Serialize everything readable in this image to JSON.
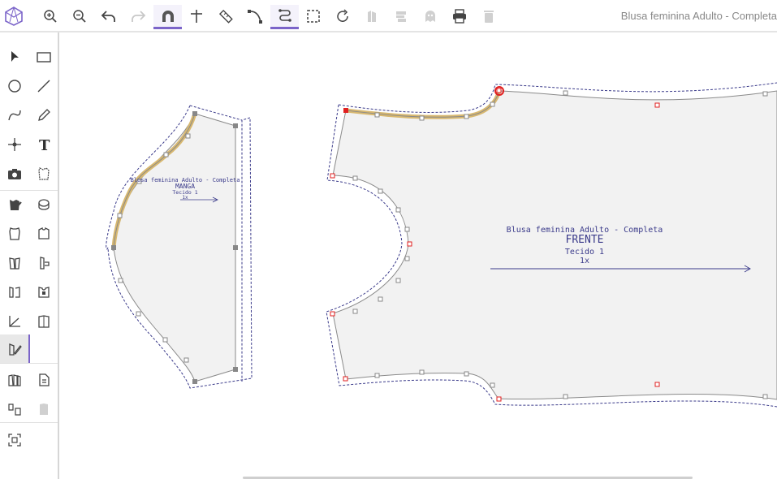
{
  "app": {
    "title": "Blusa feminina Adulto - Completa"
  },
  "toolbar": {
    "items": [
      "logo-icon",
      "zoom-in-icon",
      "zoom-out-icon",
      "undo-icon",
      "redo-icon",
      "magnet-icon",
      "cross-tool-icon",
      "ruler-icon",
      "curve-point-icon",
      "path-tool-icon",
      "selection-box-icon",
      "rotate-icon",
      "piece-copy-icon",
      "piece-layers-icon",
      "ghost-icon",
      "print-icon",
      "trash-icon"
    ],
    "active": [
      "magnet-icon",
      "path-tool-icon"
    ]
  },
  "sidebar": {
    "items": [
      "pointer-icon",
      "rectangle-icon",
      "circle-icon",
      "line-icon",
      "curve-icon",
      "pencil-icon",
      "point-icon",
      "text-icon",
      "camera-icon",
      "piece-outline-icon",
      "piece-check-icon",
      "hat-icon",
      "shirt-front-icon",
      "shirt-back-icon",
      "piece-fold-icon",
      "piece-hand-icon",
      "piece-cut-icon",
      "piece-lock-icon",
      "angle-icon",
      "piece-rotate-icon",
      "piece-edit-icon",
      "piece-group-icon",
      "piece-document-icon",
      "piece-swap-icon",
      "piece-stack-icon",
      "scan-icon"
    ],
    "active": "piece-edit-icon"
  },
  "pieces": {
    "manga": {
      "model": "Blusa feminina Adulto - Completa",
      "name": "MANGA",
      "fabric": "Tecido 1",
      "qty": "1x"
    },
    "frente": {
      "model": "Blusa feminina Adulto - Completa",
      "name": "FRENTE",
      "fabric": "Tecido 1",
      "qty": "1x"
    }
  },
  "colors": {
    "accent": "#7b64c9",
    "highlight": "#d8b870",
    "piece_fill": "#f2f2f2",
    "seam_line": "#3a3a8a",
    "marker_red": "#e02020"
  }
}
